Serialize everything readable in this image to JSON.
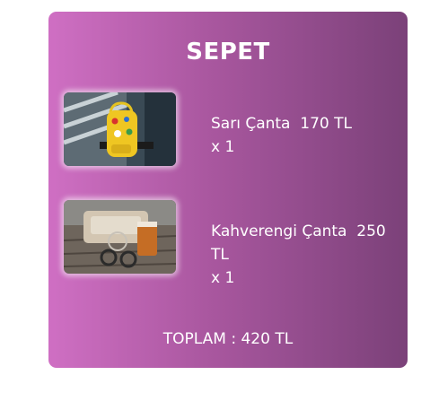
{
  "cart": {
    "title": "SEPET",
    "items": [
      {
        "name": "Sarı Çanta",
        "price": "170 TL",
        "qty_label": "x",
        "qty": "1",
        "image": "yellow-backpack-image"
      },
      {
        "name": "Kahverengi Çanta",
        "price": "250 TL",
        "qty_label": "x",
        "qty": "1",
        "image": "brown-bag-image"
      }
    ],
    "total_label": "TOPLAM : 420 TL"
  },
  "colors": {
    "gradient_start": "#cf6fc3",
    "gradient_end": "#7b4179",
    "text": "#ffffff"
  }
}
